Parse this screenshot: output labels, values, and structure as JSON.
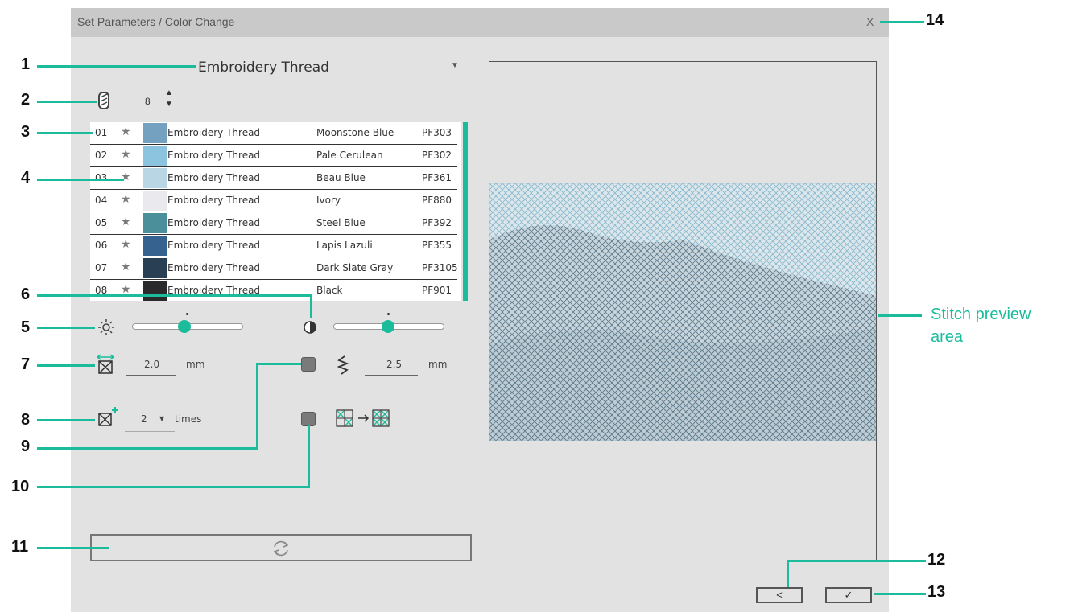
{
  "dialog": {
    "title": "Set Parameters / Color Change",
    "close_label": "X"
  },
  "thread_type": {
    "selected": "Embroidery Thread"
  },
  "color_count": {
    "value": "8",
    "up": "▲",
    "down": "▼"
  },
  "thread_list": [
    {
      "num": "01",
      "type": "Embroidery Thread",
      "name": "Moonstone Blue",
      "code": "PF303",
      "color": "#73a1bf"
    },
    {
      "num": "02",
      "type": "Embroidery Thread",
      "name": "Pale Cerulean",
      "code": "PF302",
      "color": "#8cc4df"
    },
    {
      "num": "03",
      "type": "Embroidery Thread",
      "name": "Beau Blue",
      "code": "PF361",
      "color": "#b9d6e4"
    },
    {
      "num": "04",
      "type": "Embroidery Thread",
      "name": "Ivory",
      "code": "PF880",
      "color": "#e9e9ee"
    },
    {
      "num": "05",
      "type": "Embroidery Thread",
      "name": "Steel Blue",
      "code": "PF392",
      "color": "#4a8f9a"
    },
    {
      "num": "06",
      "type": "Embroidery Thread",
      "name": "Lapis Lazuli",
      "code": "PF355",
      "color": "#35628f"
    },
    {
      "num": "07",
      "type": "Embroidery Thread",
      "name": "Dark Slate Gray",
      "code": "PF3105",
      "color": "#283f54"
    },
    {
      "num": "08",
      "type": "Embroidery Thread",
      "name": "Black",
      "code": "PF901",
      "color": "#2a2a2c"
    }
  ],
  "brightness": {
    "level": 0.48
  },
  "contrast": {
    "level": 0.5
  },
  "stitch_size": {
    "value": "2.0",
    "unit": "mm"
  },
  "zigzag": {
    "value": "2.5",
    "unit": "mm"
  },
  "repeat": {
    "value": "2",
    "unit": "times"
  },
  "callouts": {
    "c1": "1",
    "c2": "2",
    "c3": "3",
    "c4": "4",
    "c5": "5",
    "c6": "6",
    "c7": "7",
    "c8": "8",
    "c9": "9",
    "c10": "10",
    "c11": "11",
    "c12": "12",
    "c13": "13",
    "c14": "14"
  },
  "preview_label": "Stitch preview area",
  "buttons": {
    "back": "<",
    "ok": "✓"
  },
  "colors": {
    "accent": "#1abc9c",
    "dialog_bg": "#e2e2e2",
    "titlebar_bg": "#c9c9c9"
  }
}
